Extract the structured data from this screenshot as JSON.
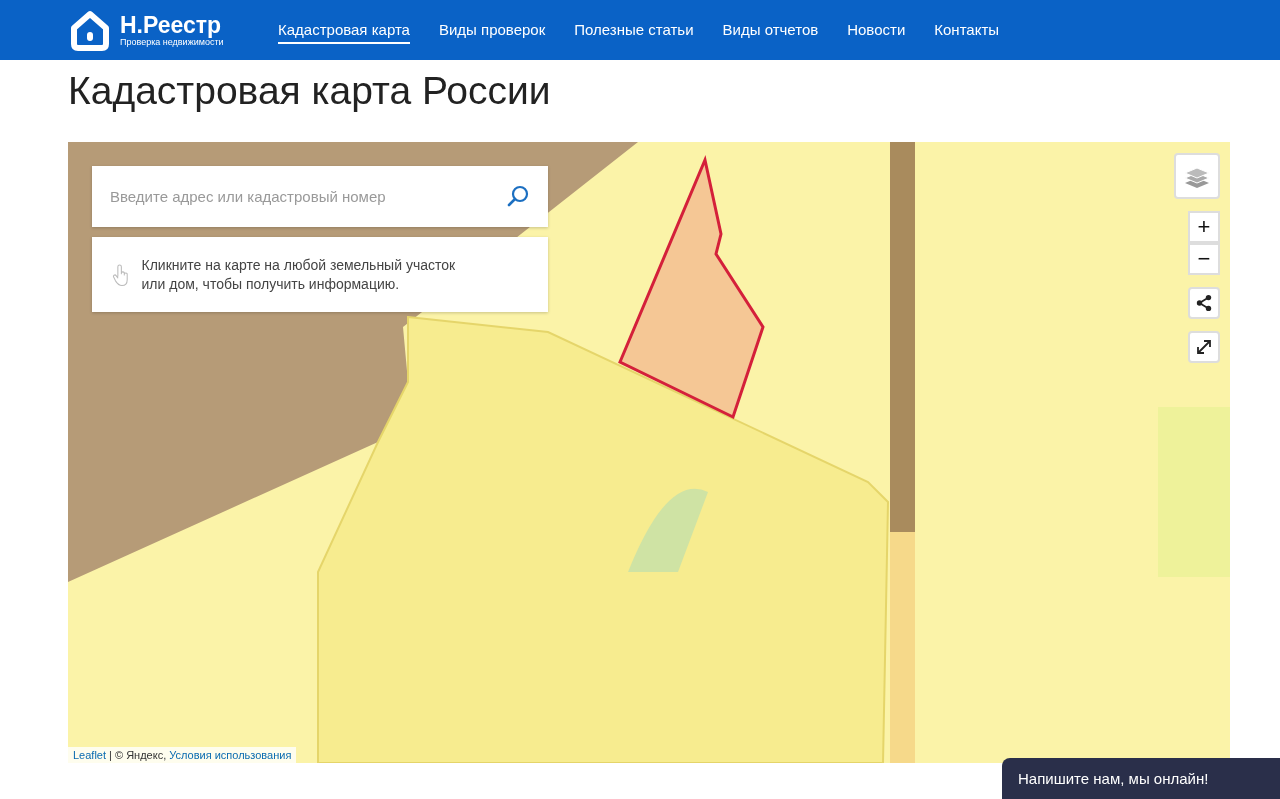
{
  "header": {
    "logo": {
      "title": "Н.Реестр",
      "subtitle": "Проверка недвижимости"
    },
    "nav": [
      {
        "label": "Кадастровая карта",
        "selected": true
      },
      {
        "label": "Виды проверок",
        "selected": false
      },
      {
        "label": "Полезные статьи",
        "selected": false
      },
      {
        "label": "Виды отчетов",
        "selected": false
      },
      {
        "label": "Новости",
        "selected": false
      },
      {
        "label": "Контакты",
        "selected": false
      }
    ]
  },
  "page_title": "Кадастровая карта России",
  "map": {
    "search": {
      "placeholder": "Введите адрес или кадастровый номер"
    },
    "hint": "Кликните на карте на любой земельный участок или дом, чтобы получить информацию.",
    "controls": {
      "zoom_in": "+",
      "zoom_out": "−"
    },
    "attribution": {
      "link": "Leaflet",
      "text": " | © Яндекс, ",
      "terms": "Условия использования"
    }
  },
  "chat": {
    "label": "Напишите нам, мы онлайн!"
  }
}
